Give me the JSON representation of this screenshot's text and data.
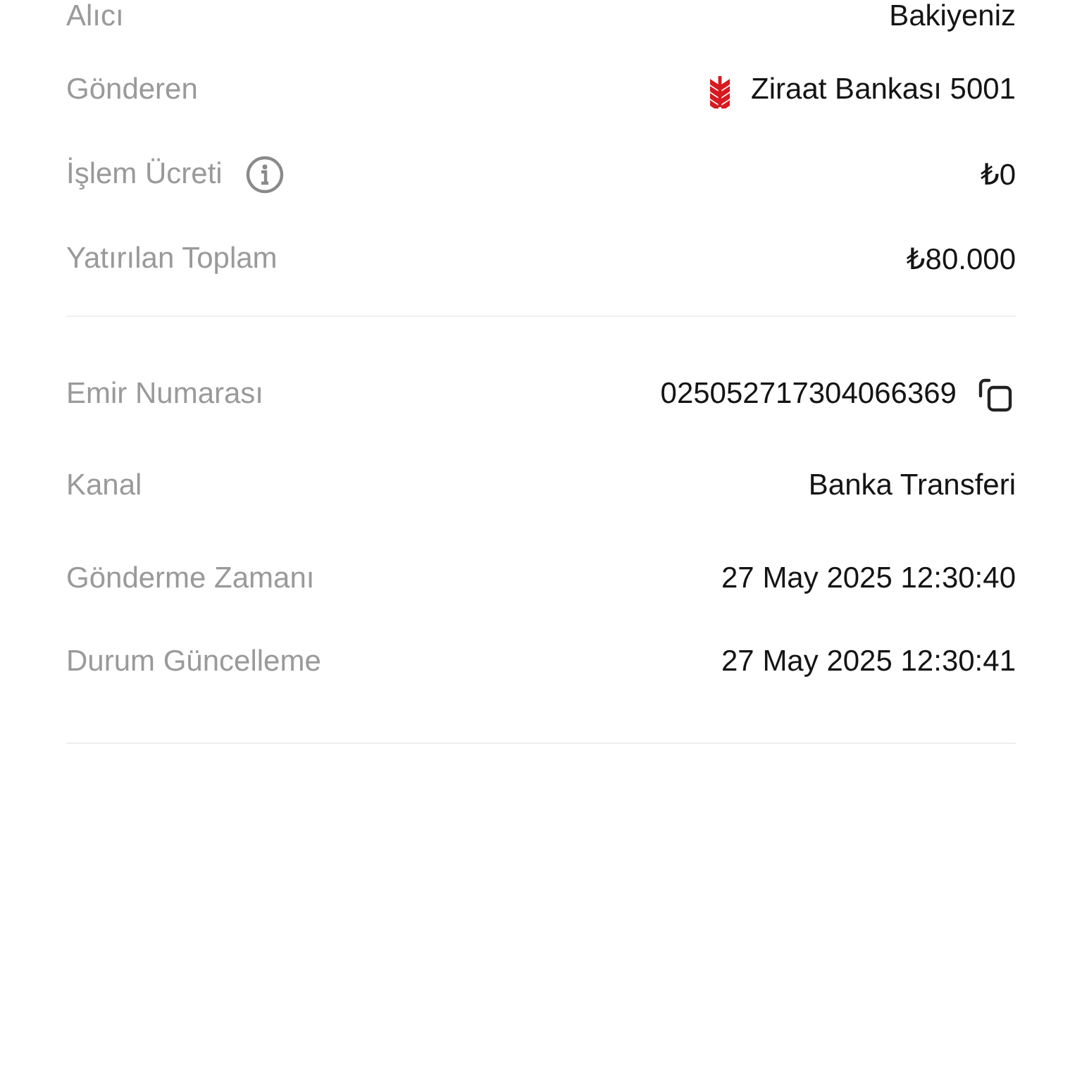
{
  "sections": [
    {
      "rows": [
        {
          "kind": "plain",
          "label": "Alıcı",
          "value": "Bakiyeniz"
        },
        {
          "kind": "bank",
          "label": "Gönderen",
          "value": "Ziraat Bankası 5001"
        },
        {
          "kind": "info",
          "label": "İşlem Ücreti",
          "value": "₺0"
        },
        {
          "kind": "plain",
          "label": "Yatırılan Toplam",
          "value": "₺80.000"
        }
      ]
    },
    {
      "rows": [
        {
          "kind": "copy",
          "label": "Emir Numarası",
          "value": "025052717304066369"
        },
        {
          "kind": "plain",
          "label": "Kanal",
          "value": "Banka Transferi"
        },
        {
          "kind": "plain",
          "label": "Gönderme Zamanı",
          "value": "27 May 2025 12:30:40"
        },
        {
          "kind": "plain",
          "label": "Durum Güncelleme",
          "value": "27 May 2025 12:30:41"
        }
      ]
    }
  ]
}
